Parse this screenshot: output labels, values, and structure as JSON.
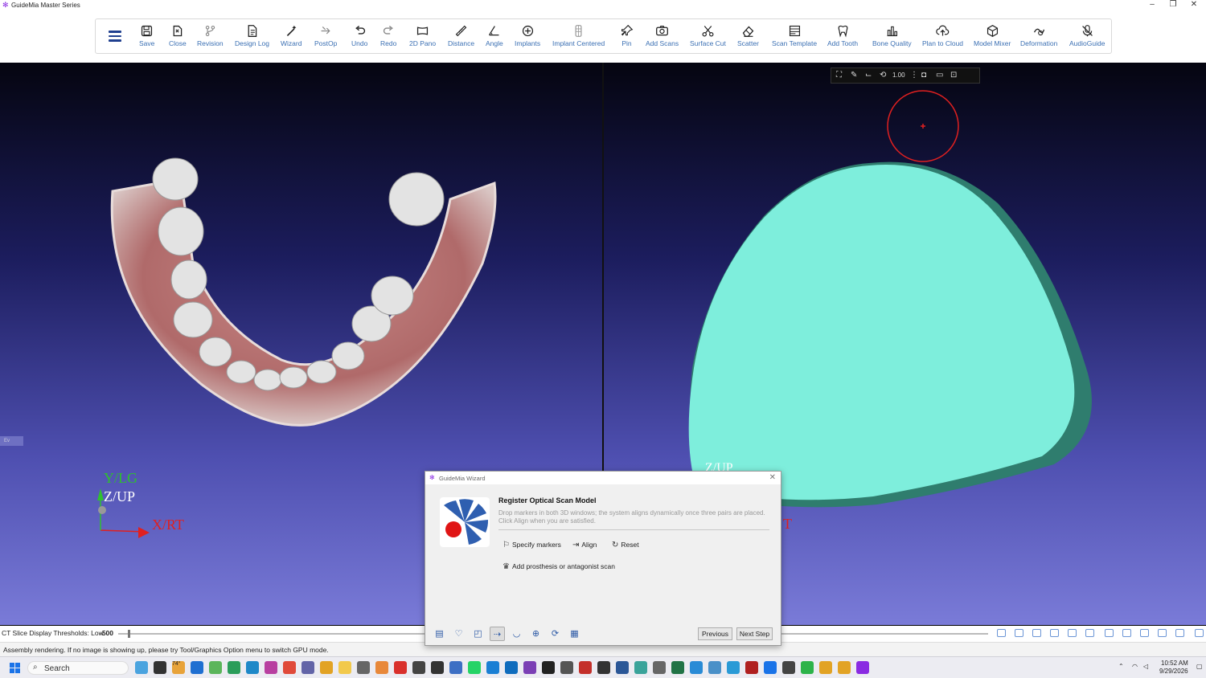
{
  "window": {
    "title": "GuideMia Master Series",
    "minimize": "–",
    "restore": "❐",
    "close": "✕"
  },
  "toolbar": {
    "items": [
      {
        "label": "Save",
        "icon": "save-icon"
      },
      {
        "label": "Close",
        "icon": "close-file-icon"
      },
      {
        "label": "Revision",
        "icon": "revision-icon"
      },
      {
        "label": "Design Log",
        "icon": "design-log-icon"
      },
      {
        "label": "Wizard",
        "icon": "wizard-icon"
      },
      {
        "label": "PostOp",
        "icon": "postop-icon"
      },
      {
        "label": "Undo",
        "icon": "undo-icon"
      },
      {
        "label": "Redo",
        "icon": "redo-icon"
      },
      {
        "label": "2D Pano",
        "icon": "pano-icon"
      },
      {
        "label": "Distance",
        "icon": "distance-icon"
      },
      {
        "label": "Angle",
        "icon": "angle-icon"
      },
      {
        "label": "Implants",
        "icon": "implants-icon"
      },
      {
        "label": "Implant Centered",
        "icon": "implant-centered-icon"
      },
      {
        "label": "Pin",
        "icon": "pin-icon"
      },
      {
        "label": "Add Scans",
        "icon": "add-scans-icon"
      },
      {
        "label": "Surface Cut",
        "icon": "scissors-icon"
      },
      {
        "label": "Scatter",
        "icon": "eraser-icon"
      },
      {
        "label": "Scan Template",
        "icon": "scan-template-icon"
      },
      {
        "label": "Add Tooth",
        "icon": "tooth-icon"
      },
      {
        "label": "Bone Quality",
        "icon": "bar-chart-icon"
      },
      {
        "label": "Plan to Cloud",
        "icon": "cloud-upload-icon"
      },
      {
        "label": "Model Mixer",
        "icon": "cube-icon"
      },
      {
        "label": "Deformation",
        "icon": "deformation-icon"
      },
      {
        "label": "AudioGuide",
        "icon": "microphone-off-icon"
      }
    ]
  },
  "left_view": {
    "axes": {
      "y": "Y/LG",
      "z": "Z/UP",
      "x": "X/RT"
    },
    "side_tab": "Ev"
  },
  "right_view": {
    "toolbar": {
      "zoom_value": "1.00"
    },
    "axes_partial": {
      "z": "Z/UP",
      "x": "T"
    }
  },
  "status": {
    "ct_label": "CT Slice Display Thresholds: Low",
    "ct_value": "-500",
    "message": "Assembly rendering. If no image is showing up, please try Tool/Graphics Option menu to switch GPU mode."
  },
  "wizard": {
    "title": "GuideMia Wizard",
    "heading": "Register Optical Scan Model",
    "description": "Drop markers in both 3D windows; the system aligns dynamically once three pairs are placed. Click Align when you are satisfied.",
    "buttons": {
      "specify": "Specify markers",
      "align": "Align",
      "reset": "Reset",
      "add_prosthesis": "Add prosthesis or antagonist scan"
    },
    "previous": "Previous",
    "next": "Next Step"
  },
  "taskbar": {
    "search": "Search",
    "weather": "74°",
    "time": "10:52 AM",
    "date": "9/29/2026"
  },
  "colors": {
    "accent": "#3a6fb3",
    "viewport_top": "#050510",
    "viewport_bottom": "#7a7bd8",
    "scan_model": "#7eeedc",
    "scan_edge": "#2f7d6e",
    "marker": "#e02020"
  }
}
